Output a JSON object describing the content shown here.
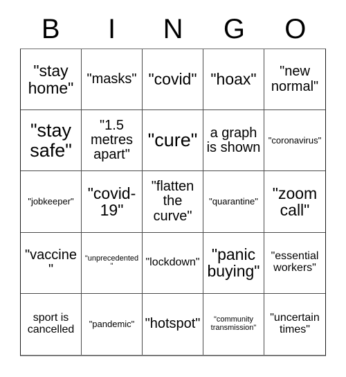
{
  "header": {
    "letters": [
      "B",
      "I",
      "N",
      "G",
      "O"
    ]
  },
  "grid": {
    "rows": 5,
    "columns": 5,
    "cells": [
      {
        "text": "\"stay home\"",
        "size": "sz-lg"
      },
      {
        "text": "\"masks\"",
        "size": "sz-md"
      },
      {
        "text": "\"covid\"",
        "size": "sz-lg"
      },
      {
        "text": "\"hoax\"",
        "size": "sz-lg"
      },
      {
        "text": "\"new normal\"",
        "size": "sz-md"
      },
      {
        "text": "\"stay safe\"",
        "size": "sz-xl"
      },
      {
        "text": "\"1.5 metres apart\"",
        "size": "sz-md"
      },
      {
        "text": "\"cure\"",
        "size": "sz-xl"
      },
      {
        "text": "a graph is shown",
        "size": "sz-md"
      },
      {
        "text": "\"coronavirus\"",
        "size": "sz-xs"
      },
      {
        "text": "\"jobkeeper\"",
        "size": "sz-xs"
      },
      {
        "text": "\"covid-19\"",
        "size": "sz-lg"
      },
      {
        "text": "\"flatten the curve\"",
        "size": "sz-md"
      },
      {
        "text": "\"quarantine\"",
        "size": "sz-xs"
      },
      {
        "text": "\"zoom call\"",
        "size": "sz-lg"
      },
      {
        "text": "\"vaccine\"",
        "size": "sz-md"
      },
      {
        "text": "\"unprecedented\"",
        "size": "sz-xxs"
      },
      {
        "text": "\"lockdown\"",
        "size": "sz-sm"
      },
      {
        "text": "\"panic buying\"",
        "size": "sz-lg"
      },
      {
        "text": "\"essential workers\"",
        "size": "sz-sm"
      },
      {
        "text": "sport is cancelled",
        "size": "sz-sm"
      },
      {
        "text": "\"pandemic\"",
        "size": "sz-xs"
      },
      {
        "text": "\"hotspot\"",
        "size": "sz-md"
      },
      {
        "text": "\"community transmission\"",
        "size": "sz-xxs"
      },
      {
        "text": "\"uncertain times\"",
        "size": "sz-sm"
      }
    ]
  }
}
